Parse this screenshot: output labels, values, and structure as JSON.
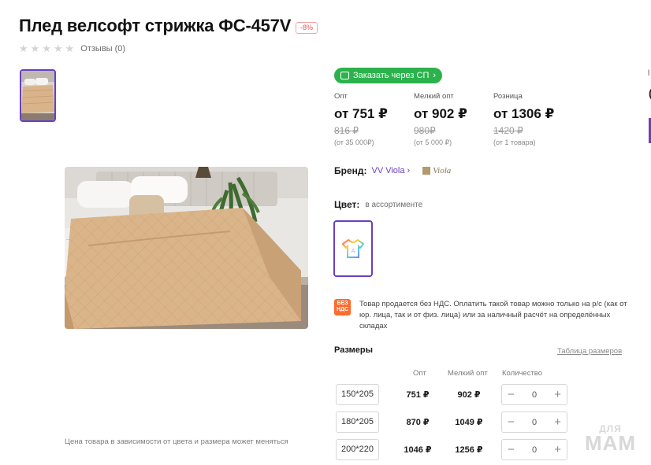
{
  "product": {
    "title": "Плед велсофт стрижка ФС-457V",
    "discount_badge": "-8%",
    "reviews_label": "Отзывы (0)",
    "price_note": "Цена товара в зависимости от цвета и размера может меняться"
  },
  "order_button": {
    "label": "Заказать через СП",
    "icon": "cart-icon"
  },
  "prices": [
    {
      "label": "Опт",
      "value": "от 751 ₽",
      "old": "816 ₽",
      "min": "(от 35 000₽)"
    },
    {
      "label": "Мелкий опт",
      "value": "от 902 ₽",
      "old": "980₽",
      "min": "(от 5 000 ₽)"
    },
    {
      "label": "Розница",
      "value": "от 1306 ₽",
      "old": "1420 ₽",
      "min": "(от 1 товара)"
    }
  ],
  "brand": {
    "label": "Бренд:",
    "name": "VV Viola",
    "logo_text": "Viola"
  },
  "color": {
    "label": "Цвет:",
    "value": "в ассортименте"
  },
  "vat": {
    "icon_text": "БЕЗ НДС",
    "text": "Товар продается без НДС. Оплатить такой товар можно только на р/с (как от юр. лица, так и от физ. лица) или за наличный расчёт на определённых складах"
  },
  "sizes": {
    "title": "Размеры",
    "table_link": "Таблица размеров",
    "headers": {
      "opt": "Опт",
      "small_opt": "Мелкий опт",
      "qty": "Количество"
    },
    "rows": [
      {
        "size": "150*205",
        "opt": "751 ₽",
        "small_opt": "902 ₽",
        "qty": "0"
      },
      {
        "size": "180*205",
        "opt": "870 ₽",
        "small_opt": "1049 ₽",
        "qty": "0"
      },
      {
        "size": "200*220",
        "opt": "1046 ₽",
        "small_opt": "1256 ₽",
        "qty": "0"
      }
    ],
    "minus": "−",
    "plus": "+"
  },
  "watermark": {
    "small": "ДЛЯ",
    "big": "МАМ"
  },
  "colors": {
    "accent": "#6a3fc0",
    "green": "#2bb24c",
    "orange": "#ff6b2c",
    "sale": "#e45656"
  }
}
